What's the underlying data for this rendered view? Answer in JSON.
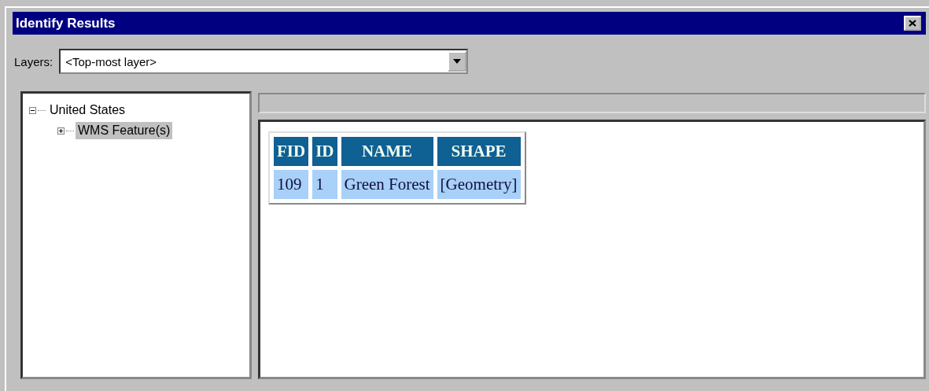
{
  "window": {
    "title": "Identify Results"
  },
  "layers": {
    "label": "Layers:",
    "value": "<Top-most layer>"
  },
  "tree": [
    {
      "label": "United States",
      "expanded": true,
      "selected": false,
      "children": [
        {
          "label": "WMS Feature(s)",
          "expanded": false,
          "selected": true
        }
      ]
    }
  ],
  "table": {
    "columns": [
      "FID",
      "ID",
      "NAME",
      "SHAPE"
    ],
    "rows": [
      [
        "109",
        "1",
        "Green Forest",
        "[Geometry]"
      ]
    ]
  }
}
